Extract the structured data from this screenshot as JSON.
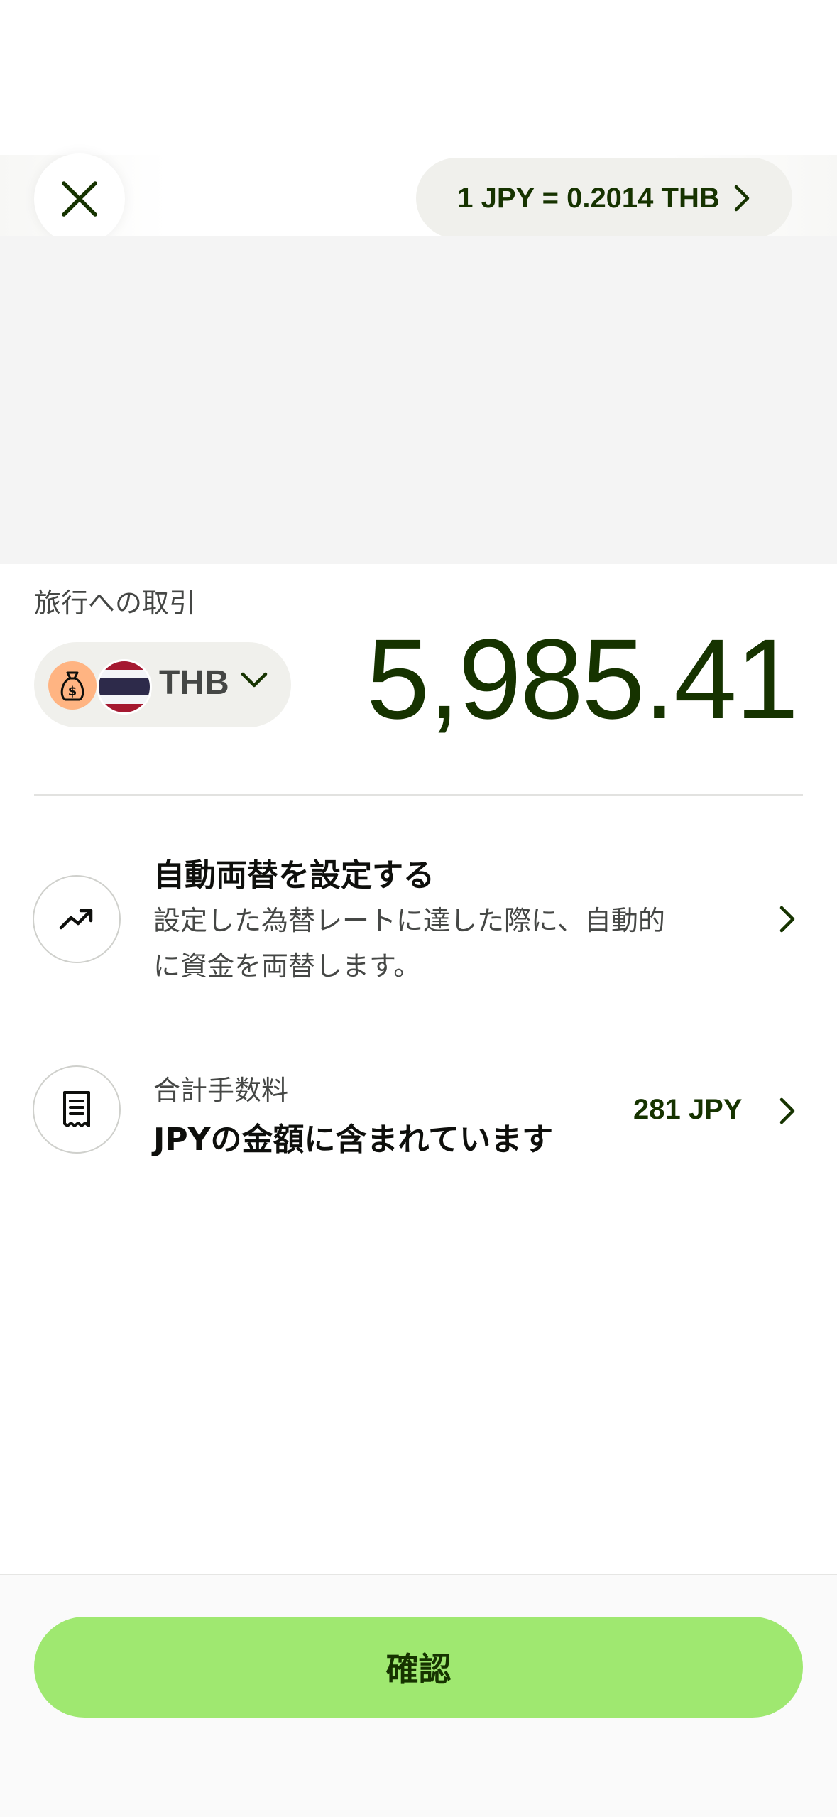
{
  "header": {
    "rate_text": "1 JPY = 0.2014 THB"
  },
  "transfer": {
    "section_label": "旅行への取引",
    "currency_code": "THB",
    "amount": "5,985.41"
  },
  "auto_convert": {
    "title": "自動両替を設定する",
    "description_line1": "設定した為替レートに達した際に、自動的",
    "description_line2": "に資金を両替します。"
  },
  "fees": {
    "label": "合計手数料",
    "description": "JPYの金額に含まれています",
    "value": "281 JPY"
  },
  "footer": {
    "confirm_label": "確認"
  },
  "colors": {
    "accent_green": "#9fe870",
    "dark_green": "#163300",
    "bag_orange": "#ffb482"
  },
  "icons": {
    "close": "close-icon",
    "rate_chevron": "chevron-right-icon",
    "currency_bag": "money-bag-icon",
    "flag": "thailand-flag-icon",
    "currency_dropdown": "chevron-down-icon",
    "auto_convert": "trending-up-icon",
    "fees": "receipt-icon"
  }
}
